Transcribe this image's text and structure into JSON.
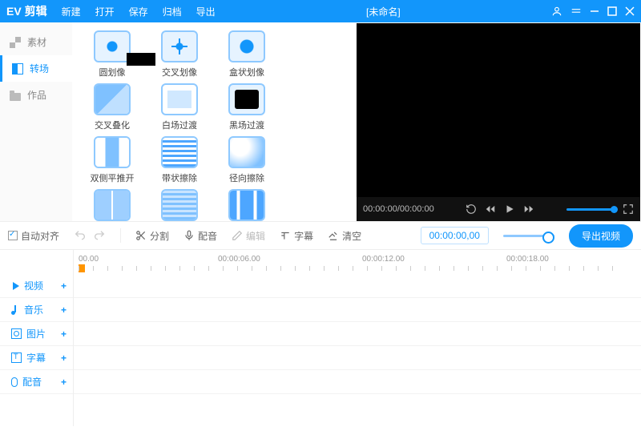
{
  "header": {
    "logo": "EV 剪辑",
    "menu": [
      "新建",
      "打开",
      "保存",
      "归档",
      "导出"
    ],
    "title": "[未命名]"
  },
  "sidebar": [
    {
      "label": "素材",
      "active": false
    },
    {
      "label": "转场",
      "active": true
    },
    {
      "label": "作品",
      "active": false
    }
  ],
  "transitions": [
    {
      "label": "圆划像",
      "t": "t-fg"
    },
    {
      "label": "交叉划像",
      "t": "t-star"
    },
    {
      "label": "盒状划像",
      "t": "t-box"
    },
    {
      "label": "交叉叠化",
      "t": "t-cross"
    },
    {
      "label": "白场过渡",
      "t": "t-white"
    },
    {
      "label": "黑场过渡",
      "t": "t-black"
    },
    {
      "label": "双侧平推开",
      "t": "t-push"
    },
    {
      "label": "带状擦除",
      "t": "t-stripe"
    },
    {
      "label": "径向擦除",
      "t": "t-radial"
    },
    {
      "label": "",
      "t": "t-two"
    },
    {
      "label": "",
      "t": "t-hstripe"
    },
    {
      "label": "",
      "t": "t-bars"
    }
  ],
  "preview": {
    "time": "00:00:00/00:00:00"
  },
  "toolbar": {
    "align": "自动对齐",
    "split": "分割",
    "dub": "配音",
    "edit": "编辑",
    "subtitle": "字幕",
    "clear": "清空",
    "timecode": "00:00:00,00",
    "export": "导出视频"
  },
  "ruler": [
    "00.00",
    "00:00:06.00",
    "00:00:12.00",
    "00:00:18.00"
  ],
  "tracks": [
    {
      "icon": "play",
      "label": "视频"
    },
    {
      "icon": "note",
      "label": "音乐"
    },
    {
      "icon": "img",
      "label": "图片"
    },
    {
      "icon": "txt",
      "label": "字幕"
    },
    {
      "icon": "mic",
      "label": "配音"
    }
  ]
}
